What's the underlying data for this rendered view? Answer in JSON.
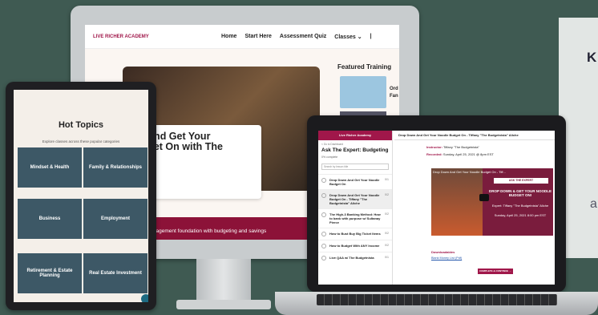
{
  "background": {
    "right_text_1": "K",
    "right_text_2": "a"
  },
  "desktop": {
    "logo": "LIVE RICHER ACADEMY",
    "nav": [
      "Home",
      "Start Here",
      "Assessment Quiz",
      "Classes ⌄",
      "|"
    ],
    "hero_title": "Down And Get Your\nle Budget On with The\netnista",
    "featured_title": "Featured Training",
    "featured_text": "Ord\nFan",
    "banner_title": "ings",
    "banner_text": "oney management foundation with budgeting and savings"
  },
  "tablet": {
    "title": "Hot Topics",
    "subtitle": "Explore classes across these popular categories",
    "tiles": [
      "Mindset & Health",
      "Family & Relationships",
      "Business",
      "Employment",
      "Retirement & Estate Planning",
      "Real Estate Investment"
    ]
  },
  "laptop": {
    "sidebar_header": "Live Richer Academy",
    "back_link": "< Go to Dashboard",
    "course_title": "Ask The Expert: Budgeting",
    "progress": "0% complete",
    "search_placeholder": "Search by lesson title",
    "lessons": [
      {
        "title": "Drop Down And Get Your Noodle Budget On",
        "count": "0/1"
      },
      {
        "title": "Drop Down And Get Your Noodle Budget On - Tiffany \"The Budgetnista\" Aliche",
        "count": "0/2"
      },
      {
        "title": "The High-3 Banking Method: How to bank with purpose w/ Sultanay Pierce",
        "count": "0/2"
      },
      {
        "title": "How to Bust Buy Big Ticket Items",
        "count": "0/2"
      },
      {
        "title": "How to Budget With ANY Income",
        "count": "0/2"
      },
      {
        "title": "Live Q&A w/ The Budgetnista",
        "count": "0/1"
      }
    ],
    "lesson_header": "Drop Down And Get Your Noodle Budget On - Tiffany \"The Budgetnista\" Aliche",
    "instructor_label": "Instructor:",
    "instructor_value": "Tiffany \"The Budgetnista\"",
    "recorded_label": "Recorded:",
    "recorded_value": "Sunday, April 25, 2021 @ 8pm EST",
    "video_title": "Drop Down And Get Your Noodle Budget On - Tiff...",
    "video_button": "ASK THE EXPERT",
    "video_text_1": "DROP DOWN & GET YOUR NOODLE BUDGET ON!",
    "video_text_2": "Expert: Tiffany \"The Budgetnista\" Aliche",
    "video_text_3": "Sunday, April 25, 2021 8:00 pm EST",
    "downloadables": "Downloadables",
    "download_link": "Blank Money List (Pdf)",
    "complete_button": "COMPLETE & CONTINUE →"
  },
  "colors": {
    "brand": "#a0174a",
    "banner": "#8c1238",
    "background": "#3f5a52"
  }
}
